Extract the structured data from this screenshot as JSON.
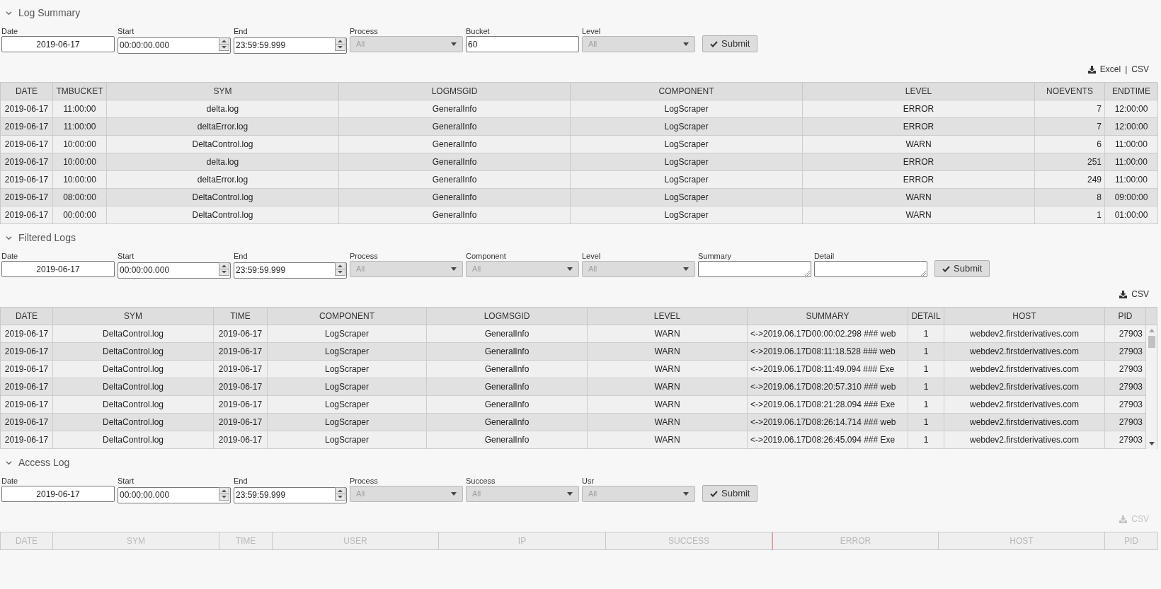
{
  "sections": [
    {
      "title": "Log Summary",
      "expanded": true,
      "filters": [
        {
          "kind": "date",
          "label": "Date",
          "value": "2019-06-17",
          "disabled": false
        },
        {
          "kind": "time",
          "label": "Start",
          "value": "00:00:00.000",
          "disabled": false
        },
        {
          "kind": "time",
          "label": "End",
          "value": "23:59:59.999",
          "disabled": false
        },
        {
          "kind": "select",
          "label": "Process",
          "value": "All",
          "disabled": true
        },
        {
          "kind": "text",
          "label": "Bucket",
          "value": "60",
          "disabled": false
        },
        {
          "kind": "select",
          "label": "Level",
          "value": "All",
          "disabled": true
        }
      ],
      "submit": "Submit",
      "export": {
        "disabled": false,
        "links": [
          "Excel",
          "CSV"
        ],
        "separator": "|"
      },
      "table": {
        "disabled": false,
        "columns": [
          {
            "label": "DATE",
            "kind": "text"
          },
          {
            "label": "TMBUCKET",
            "kind": "text"
          },
          {
            "label": "SYM",
            "kind": "text"
          },
          {
            "label": "LOGMSGID",
            "kind": "text"
          },
          {
            "label": "COMPONENT",
            "kind": "text"
          },
          {
            "label": "LEVEL",
            "kind": "text"
          },
          {
            "label": "NOEVENTS",
            "kind": "number"
          },
          {
            "label": "ENDTIME",
            "kind": "text"
          }
        ],
        "rows": [
          [
            "2019-06-17",
            "11:00:00",
            "delta.log",
            "GeneralInfo",
            "LogScraper",
            "ERROR",
            "7",
            "12:00:00"
          ],
          [
            "2019-06-17",
            "11:00:00",
            "deltaError.log",
            "GeneralInfo",
            "LogScraper",
            "ERROR",
            "7",
            "12:00:00"
          ],
          [
            "2019-06-17",
            "10:00:00",
            "DeltaControl.log",
            "GeneralInfo",
            "LogScraper",
            "WARN",
            "6",
            "11:00:00"
          ],
          [
            "2019-06-17",
            "10:00:00",
            "delta.log",
            "GeneralInfo",
            "LogScraper",
            "ERROR",
            "251",
            "11:00:00"
          ],
          [
            "2019-06-17",
            "10:00:00",
            "deltaError.log",
            "GeneralInfo",
            "LogScraper",
            "ERROR",
            "249",
            "11:00:00"
          ],
          [
            "2019-06-17",
            "08:00:00",
            "DeltaControl.log",
            "GeneralInfo",
            "LogScraper",
            "WARN",
            "8",
            "09:00:00"
          ],
          [
            "2019-06-17",
            "00:00:00",
            "DeltaControl.log",
            "GeneralInfo",
            "LogScraper",
            "WARN",
            "1",
            "01:00:00"
          ]
        ]
      }
    },
    {
      "title": "Filtered Logs",
      "expanded": true,
      "filters": [
        {
          "kind": "date",
          "label": "Date",
          "value": "2019-06-17",
          "disabled": false
        },
        {
          "kind": "time",
          "label": "Start",
          "value": "00:00:00.000",
          "disabled": false
        },
        {
          "kind": "time",
          "label": "End",
          "value": "23:59:59.999",
          "disabled": false
        },
        {
          "kind": "select",
          "label": "Process",
          "value": "All",
          "disabled": true
        },
        {
          "kind": "select",
          "label": "Component",
          "value": "All",
          "disabled": true
        },
        {
          "kind": "select",
          "label": "Level",
          "value": "All",
          "disabled": true
        },
        {
          "kind": "textarea",
          "label": "Summary",
          "disabled": false
        },
        {
          "kind": "textarea",
          "label": "Detail",
          "disabled": false
        }
      ],
      "submit": "Submit",
      "export": {
        "disabled": false,
        "links": [
          "CSV"
        ]
      },
      "table": {
        "disabled": false,
        "scrollable": true,
        "columns": [
          {
            "label": "DATE",
            "kind": "text"
          },
          {
            "label": "SYM",
            "kind": "text"
          },
          {
            "label": "TIME",
            "kind": "text"
          },
          {
            "label": "COMPONENT",
            "kind": "text"
          },
          {
            "label": "LOGMSGID",
            "kind": "text"
          },
          {
            "label": "LEVEL",
            "kind": "text"
          },
          {
            "label": "SUMMARY",
            "kind": "long_text"
          },
          {
            "label": "DETAIL",
            "kind": "text"
          },
          {
            "label": "HOST",
            "kind": "text"
          },
          {
            "label": "PID",
            "kind": "number"
          }
        ],
        "rows": [
          [
            "2019-06-17",
            "DeltaControl.log",
            "2019-06-17",
            "LogScraper",
            "GeneralInfo",
            "WARN",
            "<->2019.06.17D00:00:02.298 ### web",
            "1",
            "webdev2.firstderivatives.com",
            "27903"
          ],
          [
            "2019-06-17",
            "DeltaControl.log",
            "2019-06-17",
            "LogScraper",
            "GeneralInfo",
            "WARN",
            "<->2019.06.17D08:11:18.528 ### web",
            "1",
            "webdev2.firstderivatives.com",
            "27903"
          ],
          [
            "2019-06-17",
            "DeltaControl.log",
            "2019-06-17",
            "LogScraper",
            "GeneralInfo",
            "WARN",
            "<->2019.06.17D08:11:49.094 ### Exe",
            "1",
            "webdev2.firstderivatives.com",
            "27903"
          ],
          [
            "2019-06-17",
            "DeltaControl.log",
            "2019-06-17",
            "LogScraper",
            "GeneralInfo",
            "WARN",
            "<->2019.06.17D08:20:57.310 ### web",
            "1",
            "webdev2.firstderivatives.com",
            "27903"
          ],
          [
            "2019-06-17",
            "DeltaControl.log",
            "2019-06-17",
            "LogScraper",
            "GeneralInfo",
            "WARN",
            "<->2019.06.17D08:21:28.094 ### Exe",
            "1",
            "webdev2.firstderivatives.com",
            "27903"
          ],
          [
            "2019-06-17",
            "DeltaControl.log",
            "2019-06-17",
            "LogScraper",
            "GeneralInfo",
            "WARN",
            "<->2019.06.17D08:26:14.714 ### web",
            "1",
            "webdev2.firstderivatives.com",
            "27903"
          ],
          [
            "2019-06-17",
            "DeltaControl.log",
            "2019-06-17",
            "LogScraper",
            "GeneralInfo",
            "WARN",
            "<->2019.06.17D08:26:45.094 ### Exe",
            "1",
            "webdev2.firstderivatives.com",
            "27903"
          ]
        ]
      }
    },
    {
      "title": "Access Log",
      "expanded": true,
      "filters": [
        {
          "kind": "date",
          "label": "Date",
          "value": "2019-06-17",
          "disabled": false
        },
        {
          "kind": "time",
          "label": "Start",
          "value": "00:00:00.000",
          "disabled": false
        },
        {
          "kind": "time",
          "label": "End",
          "value": "23:59:59.999",
          "disabled": false
        },
        {
          "kind": "select",
          "label": "Process",
          "value": "All",
          "disabled": true
        },
        {
          "kind": "select",
          "label": "Success",
          "value": "All",
          "disabled": true
        },
        {
          "kind": "select",
          "label": "Usr",
          "value": "All",
          "disabled": true
        }
      ],
      "submit": "Submit",
      "export": {
        "disabled": true,
        "links": [
          "CSV"
        ]
      },
      "table": {
        "disabled": true,
        "columns": [
          {
            "label": "DATE",
            "resize_marker": false
          },
          {
            "label": "SYM",
            "resize_marker": false
          },
          {
            "label": "TIME",
            "resize_marker": false
          },
          {
            "label": "USER",
            "resize_marker": false
          },
          {
            "label": "IP",
            "resize_marker": false
          },
          {
            "label": "SUCCESS",
            "resize_marker": false
          },
          {
            "label": "ERROR",
            "resize_marker": true
          },
          {
            "label": "HOST",
            "resize_marker": false
          },
          {
            "label": "PID",
            "resize_marker": false
          }
        ]
      }
    }
  ]
}
